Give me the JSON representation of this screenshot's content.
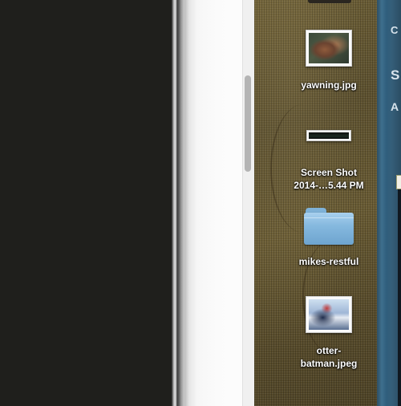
{
  "desktop": {
    "icons": [
      {
        "label": "yawning.jpg",
        "kind": "image-thumbnail"
      },
      {
        "label": "Screen Shot\n2014-…5.44 PM",
        "kind": "image-thumbnail"
      },
      {
        "label": "mikes-restful",
        "kind": "folder"
      },
      {
        "label": "otter-\nbatman.jpeg",
        "kind": "image-thumbnail"
      }
    ]
  },
  "right_window": {
    "edge_chars": [
      "C",
      "S",
      "A"
    ]
  },
  "colors": {
    "folder": "#86b9df",
    "desktop_texture": "#5e5230",
    "dark_window": "#1f1f1c",
    "right_window": "#2f5e7c"
  }
}
